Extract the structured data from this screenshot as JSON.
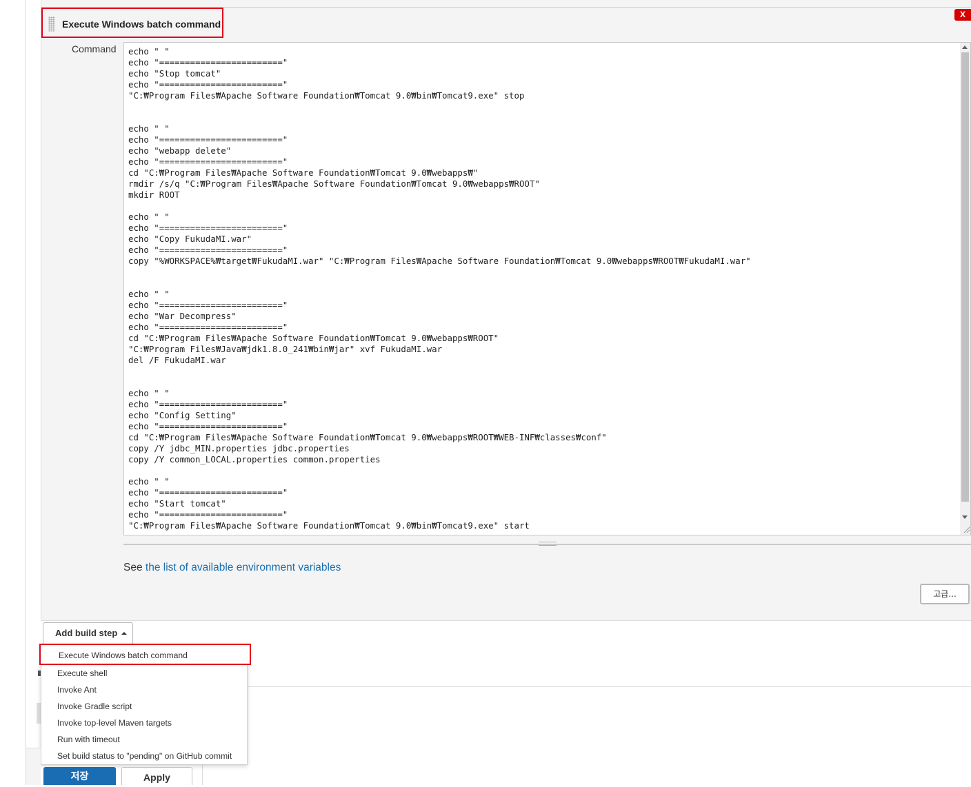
{
  "build_step": {
    "title": "Execute Windows batch command",
    "close_label": "X",
    "command_label": "Command",
    "command": "echo \" \"\necho \"========================\"\necho \"Stop tomcat\"\necho \"========================\"\n\"C:₩Program Files₩Apache Software Foundation₩Tomcat 9.0₩bin₩Tomcat9.exe\" stop\n\n\necho \" \"\necho \"========================\"\necho \"webapp delete\"\necho \"========================\"\ncd \"C:₩Program Files₩Apache Software Foundation₩Tomcat 9.0₩webapps₩\"\nrmdir /s/q \"C:₩Program Files₩Apache Software Foundation₩Tomcat 9.0₩webapps₩ROOT\"\nmkdir ROOT\n\necho \" \"\necho \"========================\"\necho \"Copy FukudaMI.war\"\necho \"========================\"\ncopy \"%WORKSPACE%₩target₩FukudaMI.war\" \"C:₩Program Files₩Apache Software Foundation₩Tomcat 9.0₩webapps₩ROOT₩FukudaMI.war\"\n\n\necho \" \"\necho \"========================\"\necho \"War Decompress\"\necho \"========================\"\ncd \"C:₩Program Files₩Apache Software Foundation₩Tomcat 9.0₩webapps₩ROOT\"\n\"C:₩Program Files₩Java₩jdk1.8.0_241₩bin₩jar\" xvf FukudaMI.war\ndel /F FukudaMI.war\n\n\necho \" \"\necho \"========================\"\necho \"Config Setting\"\necho \"========================\"\ncd \"C:₩Program Files₩Apache Software Foundation₩Tomcat 9.0₩webapps₩ROOT₩WEB-INF₩classes₩conf\"\ncopy /Y jdbc_MIN.properties jdbc.properties\ncopy /Y common_LOCAL.properties common.properties\n\necho \" \"\necho \"========================\"\necho \"Start tomcat\"\necho \"========================\"\n\"C:₩Program Files₩Apache Software Foundation₩Tomcat 9.0₩bin₩Tomcat9.exe\" start",
    "see_prefix": "See",
    "env_link": "the list of available environment variables",
    "advanced_label": "고급..."
  },
  "add_build_step": {
    "label": "Add build step",
    "menu_items": [
      "Execute Windows batch command",
      "Execute shell",
      "Invoke Ant",
      "Invoke Gradle script",
      "Invoke top-level Maven targets",
      "Run with timeout",
      "Set build status to \"pending\" on GitHub commit"
    ]
  },
  "footer": {
    "save_label": "저장",
    "apply_label": "Apply"
  },
  "colors": {
    "highlight_border": "#e0001b",
    "link": "#1a6fb0",
    "save_button": "#1b6db3",
    "close_button": "#d60000"
  }
}
